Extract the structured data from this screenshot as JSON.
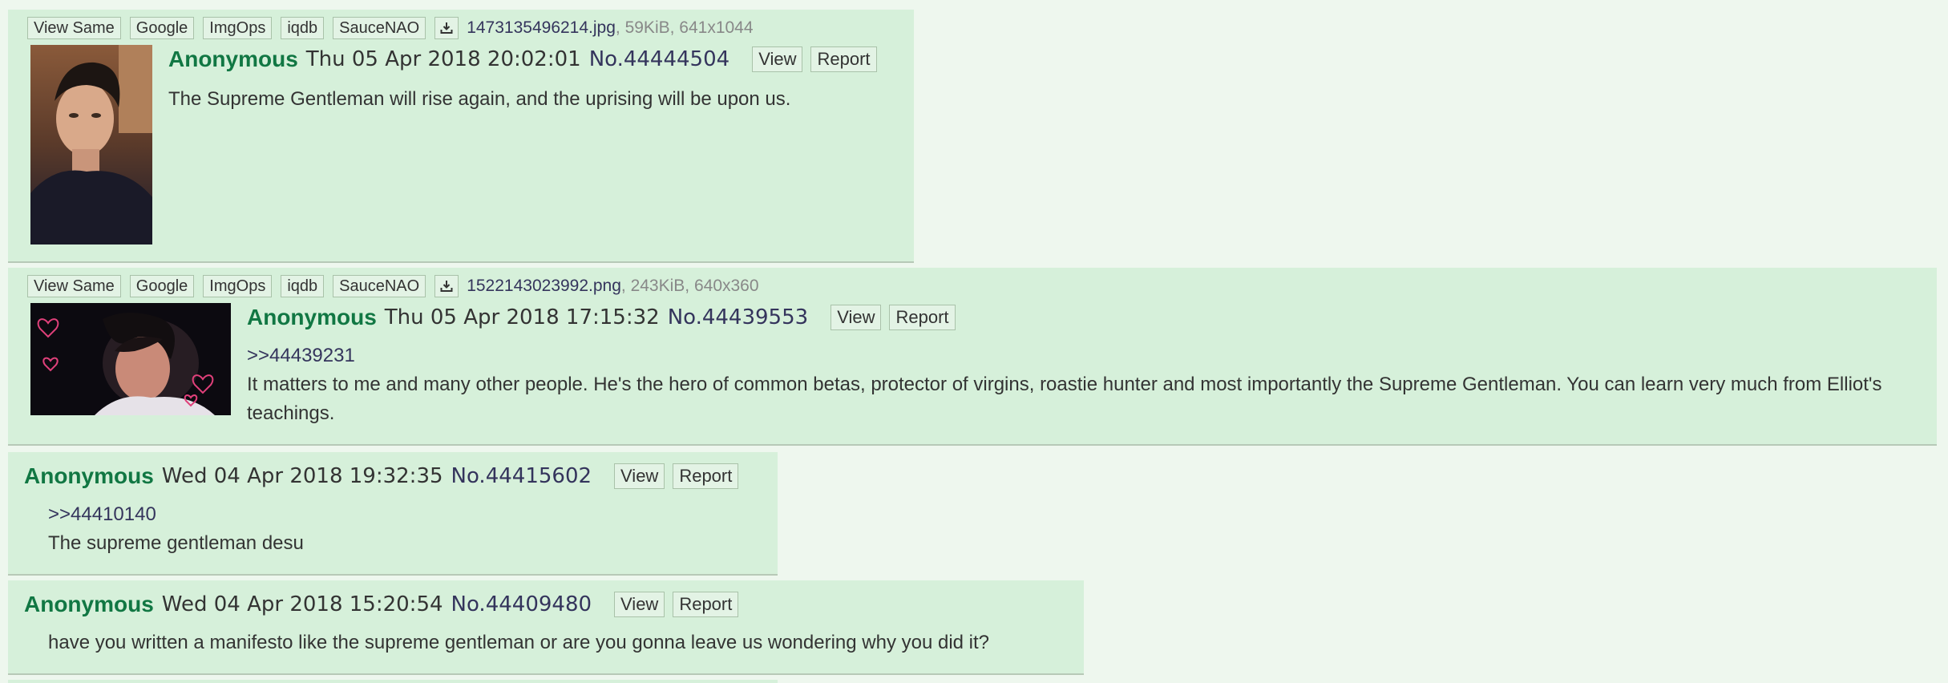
{
  "tool_labels": {
    "view_same": "View Same",
    "google": "Google",
    "imgops": "ImgOps",
    "iqdb": "iqdb",
    "saucenao": "SauceNAO"
  },
  "posts": [
    {
      "file_name": "1473135496214.jpg",
      "file_meta": ", 59KiB, 641x1044",
      "name": "Anonymous",
      "date": "Thu 05 Apr 2018 20:02:01",
      "post_no": "No.44444504",
      "view_label": "View",
      "report_label": "Report",
      "quote": "",
      "text": "The Supreme Gentleman will rise again, and the uprising will be upon us."
    },
    {
      "file_name": "1522143023992.png",
      "file_meta": ", 243KiB, 640x360",
      "name": "Anonymous",
      "date": "Thu 05 Apr 2018 17:15:32",
      "post_no": "No.44439553",
      "view_label": "View",
      "report_label": "Report",
      "quote": ">>44439231",
      "text": "It matters to me and many other people. He's the hero of common betas, protector of virgins, roastie hunter and most importantly the Supreme Gentleman. You can learn very much from Elliot's teachings."
    },
    {
      "name": "Anonymous",
      "date": "Wed 04 Apr 2018 19:32:35",
      "post_no": "No.44415602",
      "view_label": "View",
      "report_label": "Report",
      "quote": ">>44410140",
      "text": "The supreme gentleman desu"
    },
    {
      "name": "Anonymous",
      "date": "Wed 04 Apr 2018 15:20:54",
      "post_no": "No.44409480",
      "view_label": "View",
      "report_label": "Report",
      "quote": "",
      "text": "have you written a manifesto like the supreme gentleman or are you gonna leave us wondering why you did it?"
    }
  ],
  "colors": {
    "page_bg": "#eef7ee",
    "post_bg": "#d6f0da",
    "name": "#117743",
    "link": "#34345c"
  },
  "icons": {
    "download": "download-icon"
  }
}
